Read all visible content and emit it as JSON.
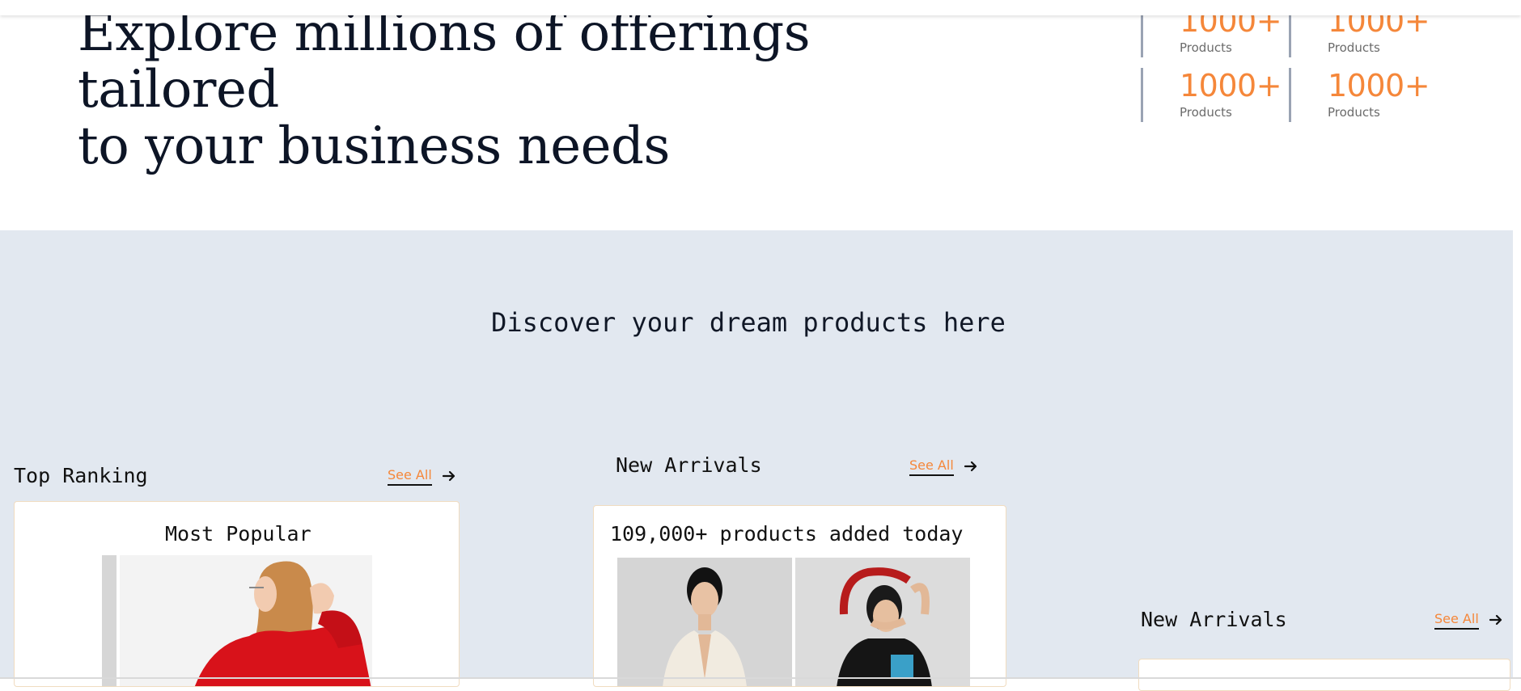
{
  "header": {
    "background": "#ffffff"
  },
  "hero": {
    "title_line1": "Explore millions of offerings tailored",
    "title_line2": "to your business needs"
  },
  "stats": [
    {
      "value": "1000+",
      "label": "Products"
    },
    {
      "value": "1000+",
      "label": "Products"
    },
    {
      "value": "1000+",
      "label": "Products"
    },
    {
      "value": "1000+",
      "label": "Products"
    }
  ],
  "discover": {
    "title": "Discover your dream products here",
    "background": "#e2e8f0"
  },
  "sections": {
    "top_ranking": {
      "title": "Top Ranking",
      "see_all": "See All",
      "card_title": "Most Popular"
    },
    "new_arrivals": {
      "title": "New Arrivals",
      "see_all": "See All",
      "card_title": "109,000+ products added today"
    },
    "new_arrivals_2": {
      "title": "New Arrivals",
      "see_all": "See All"
    }
  },
  "colors": {
    "accent": "#f5873a",
    "text": "#111111",
    "title": "#0d1526"
  }
}
